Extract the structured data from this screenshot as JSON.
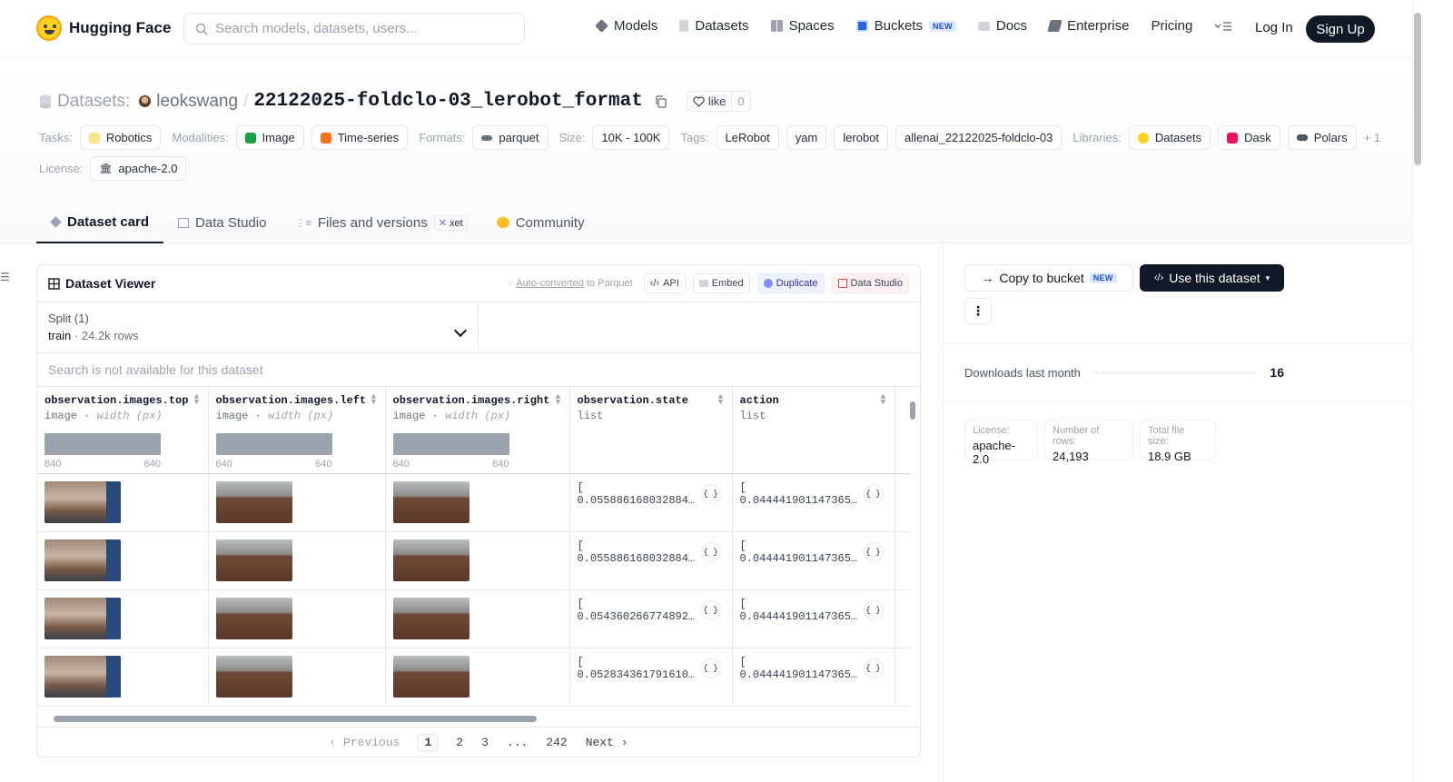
{
  "brand": {
    "name": "Hugging Face"
  },
  "search": {
    "placeholder": "Search models, datasets, users..."
  },
  "nav": {
    "items": [
      {
        "label": "Models",
        "icon": "cube-icon",
        "color": "#6b7280"
      },
      {
        "label": "Datasets",
        "icon": "database-icon",
        "color": "#9ca3af"
      },
      {
        "label": "Spaces",
        "icon": "grid-icon",
        "color": "#9ca3af"
      },
      {
        "label": "Buckets",
        "icon": "bucket-icon",
        "color": "#2563eb",
        "badge": "NEW"
      },
      {
        "label": "Docs",
        "icon": "book-icon",
        "color": "#9ca3af"
      },
      {
        "label": "Enterprise",
        "icon": "enterprise-icon",
        "color": "#6b7280"
      },
      {
        "label": "Pricing"
      }
    ],
    "login": "Log In",
    "signup": "Sign Up"
  },
  "title": {
    "label": "Datasets:",
    "owner": "leokswang",
    "slash": "/",
    "name": "22122025-foldclo-03_lerobot_format",
    "like_label": "like",
    "like_count": "0"
  },
  "meta": {
    "tasks_label": "Tasks:",
    "tasks": [
      "Robotics"
    ],
    "modalities_label": "Modalities:",
    "modalities": [
      "Image",
      "Time-series"
    ],
    "formats_label": "Formats:",
    "formats": [
      "parquet"
    ],
    "size_label": "Size:",
    "size": "10K - 100K",
    "tags_label": "Tags:",
    "tags": [
      "LeRobot",
      "yam",
      "lerobot",
      "allenai_22122025-foldclo-03"
    ],
    "libraries_label": "Libraries:",
    "libraries": [
      "Datasets",
      "Dask",
      "Polars"
    ],
    "libraries_more": "+ 1",
    "license_label": "License:",
    "license": "apache-2.0"
  },
  "tabs": [
    {
      "label": "Dataset card",
      "active": true
    },
    {
      "label": "Data Studio"
    },
    {
      "label": "Files and versions",
      "badge": "xet"
    },
    {
      "label": "Community"
    }
  ],
  "viewer": {
    "title": "Dataset Viewer",
    "auto_converted": "Auto-converted",
    "to_parquet": " to Parquet",
    "api": "API",
    "embed": "Embed",
    "duplicate": "Duplicate",
    "data_studio": "Data Studio",
    "split_label": "Split (1)",
    "split_name": "train",
    "split_rows": "24.2k rows",
    "search_na": "Search is not available for this dataset",
    "columns": [
      {
        "name": "observation.images.top",
        "type": "image",
        "sub": "width (px)",
        "min": "640",
        "max": "640"
      },
      {
        "name": "observation.images.left",
        "type": "image",
        "sub": "width (px)",
        "min": "640",
        "max": "640"
      },
      {
        "name": "observation.images.right",
        "type": "image",
        "sub": "width (px)",
        "min": "640",
        "max": "640"
      },
      {
        "name": "observation.state",
        "type": "list"
      },
      {
        "name": "action",
        "type": "list"
      }
    ],
    "rows": [
      {
        "state": "[ 0.055886168032884…",
        "action": "[ 0.044441901147365…"
      },
      {
        "state": "[ 0.055886168032884…",
        "action": "[ 0.044441901147365…"
      },
      {
        "state": "[ 0.054360266774892…",
        "action": "[ 0.044441901147365…"
      },
      {
        "state": "[ 0.052834361791610…",
        "action": "[ 0.044441901147365…"
      }
    ],
    "pager": {
      "prev": "Previous",
      "pages": [
        "1",
        "2",
        "3",
        "...",
        "242"
      ],
      "next": "Next"
    }
  },
  "sidebar": {
    "copy_bucket": "Copy to bucket",
    "copy_badge": "NEW",
    "use_dataset": "Use this dataset",
    "downloads_label": "Downloads last month",
    "downloads": "16",
    "cards": [
      {
        "k": "License:",
        "v": "apache-2.0"
      },
      {
        "k": "Number of rows:",
        "v": "24,193"
      },
      {
        "k": "Total file size:",
        "v": "18.9 GB"
      }
    ]
  }
}
